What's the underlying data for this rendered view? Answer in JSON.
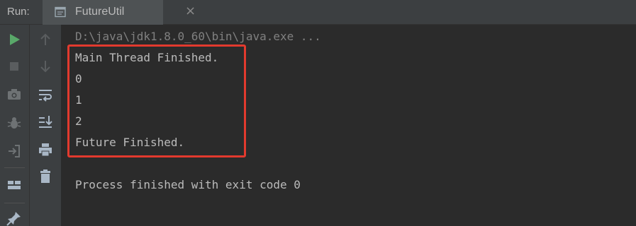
{
  "run_panel": {
    "label": "Run:",
    "tab": {
      "title": "FutureUtil",
      "close_glyph": "×",
      "icon": "window-icon"
    }
  },
  "toolbar_left": {
    "buttons": [
      "play-icon",
      "stop-icon",
      "camera-icon",
      "debug-icon",
      "login-icon",
      "layout-icon",
      "pin-icon"
    ]
  },
  "toolbar_right": {
    "buttons": [
      "arrow-up-icon",
      "arrow-down-icon",
      "soft-wrap-icon",
      "scroll-to-end-icon",
      "print-icon",
      "trash-icon"
    ]
  },
  "console": {
    "command": "D:\\java\\jdk1.8.0_60\\bin\\java.exe ...",
    "output_lines": [
      "Main Thread Finished.",
      "0",
      "1",
      "2",
      "Future Finished."
    ],
    "process_message": "Process finished with exit code 0"
  },
  "colors": {
    "background": "#2b2b2b",
    "toolbar": "#3c3f41",
    "text": "#bbbbbb",
    "command_text": "#808080",
    "run_green": "#59a869",
    "highlight_red": "#e23a2e"
  }
}
